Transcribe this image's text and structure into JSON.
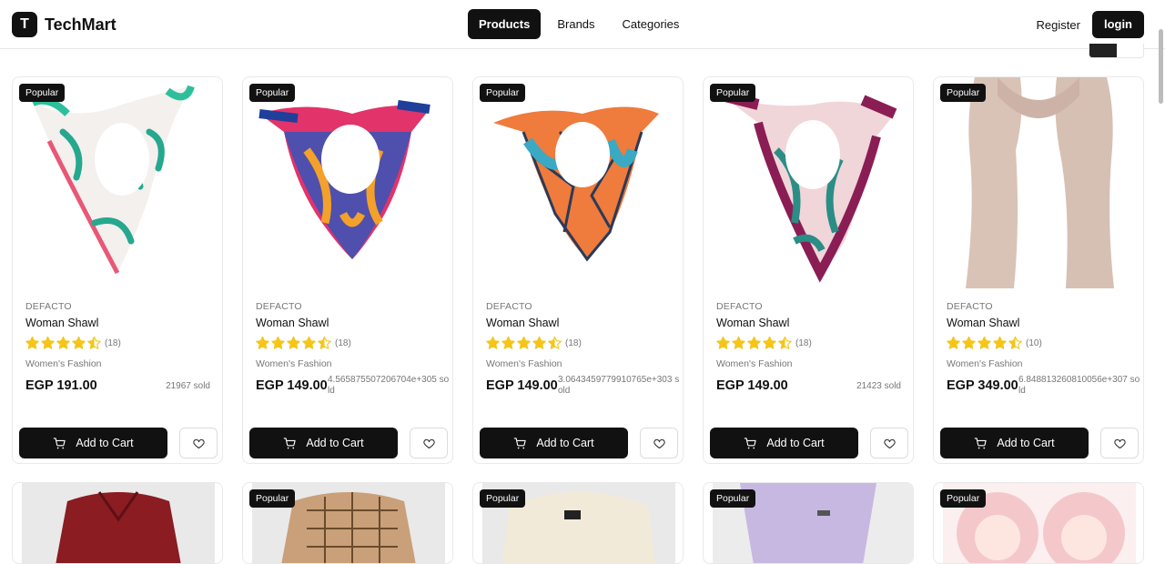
{
  "header": {
    "logo_letter": "T",
    "app_name": "TechMart",
    "nav": [
      {
        "label": "Products",
        "active": true
      },
      {
        "label": "Brands",
        "active": false
      },
      {
        "label": "Categories",
        "active": false
      }
    ],
    "register_label": "Register",
    "login_label": "login"
  },
  "products": [
    {
      "badge": "Popular",
      "brand": "DEFACTO",
      "title": "Woman Shawl",
      "rating": 4.5,
      "reviews": "(18)",
      "category": "Women's Fashion",
      "price": "EGP 191.00",
      "sold": "21967 sold",
      "add_label": "Add to Cart"
    },
    {
      "badge": "Popular",
      "brand": "DEFACTO",
      "title": "Woman Shawl",
      "rating": 4.5,
      "reviews": "(18)",
      "category": "Women's Fashion",
      "price": "EGP 149.00",
      "sold": "4.565875507206704e+305 sold",
      "add_label": "Add to Cart"
    },
    {
      "badge": "Popular",
      "brand": "DEFACTO",
      "title": "Woman Shawl",
      "rating": 4.5,
      "reviews": "(18)",
      "category": "Women's Fashion",
      "price": "EGP 149.00",
      "sold": "3.0643459779910765e+303 sold",
      "add_label": "Add to Cart"
    },
    {
      "badge": "Popular",
      "brand": "DEFACTO",
      "title": "Woman Shawl",
      "rating": 4.5,
      "reviews": "(18)",
      "category": "Women's Fashion",
      "price": "EGP 149.00",
      "sold": "21423 sold",
      "add_label": "Add to Cart"
    },
    {
      "badge": "Popular",
      "brand": "DEFACTO",
      "title": "Woman Shawl",
      "rating": 4.5,
      "reviews": "(10)",
      "category": "Women's Fashion",
      "price": "EGP 349.00",
      "sold": "6.848813260810056e+307 sold",
      "add_label": "Add to Cart"
    }
  ],
  "row2_badges": [
    "",
    "Popular",
    "Popular",
    "Popular",
    "Popular"
  ],
  "icons": {
    "cart": "cart-icon",
    "heart": "heart-icon",
    "star": "star-icon"
  },
  "colors": {
    "primary": "#111111",
    "star": "#f5c518"
  }
}
